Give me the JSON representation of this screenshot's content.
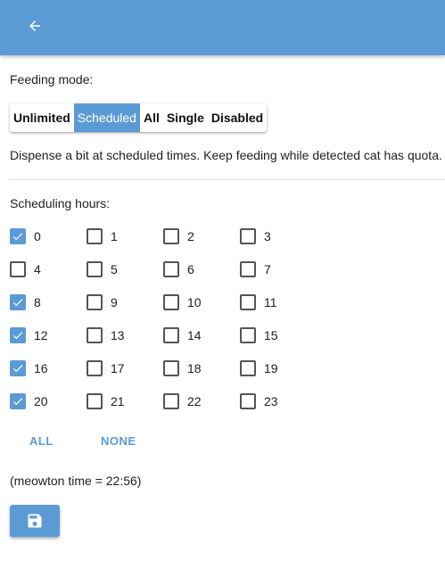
{
  "header": {
    "back_icon": "arrow-left-icon"
  },
  "feeding": {
    "label": "Feeding mode:",
    "modes": [
      "Unlimited",
      "Scheduled",
      "All",
      "Single",
      "Disabled"
    ],
    "selected": "Scheduled",
    "description": "Dispense a bit at scheduled times. Keep feeding while detected cat has quota."
  },
  "schedule": {
    "label": "Scheduling hours:",
    "hours": [
      {
        "label": "0",
        "checked": true
      },
      {
        "label": "1",
        "checked": false
      },
      {
        "label": "2",
        "checked": false
      },
      {
        "label": "3",
        "checked": false
      },
      {
        "label": "4",
        "checked": false
      },
      {
        "label": "5",
        "checked": false
      },
      {
        "label": "6",
        "checked": false
      },
      {
        "label": "7",
        "checked": false
      },
      {
        "label": "8",
        "checked": true
      },
      {
        "label": "9",
        "checked": false
      },
      {
        "label": "10",
        "checked": false
      },
      {
        "label": "11",
        "checked": false
      },
      {
        "label": "12",
        "checked": true
      },
      {
        "label": "13",
        "checked": false
      },
      {
        "label": "14",
        "checked": false
      },
      {
        "label": "15",
        "checked": false
      },
      {
        "label": "16",
        "checked": true
      },
      {
        "label": "17",
        "checked": false
      },
      {
        "label": "18",
        "checked": false
      },
      {
        "label": "19",
        "checked": false
      },
      {
        "label": "20",
        "checked": true
      },
      {
        "label": "21",
        "checked": false
      },
      {
        "label": "22",
        "checked": false
      },
      {
        "label": "23",
        "checked": false
      }
    ],
    "all_label": "ALL",
    "none_label": "NONE"
  },
  "time_text": "(meowton time = 22:56)",
  "save": {
    "icon": "floppy-disk-icon"
  },
  "colors": {
    "accent": "#5b9bd5"
  }
}
